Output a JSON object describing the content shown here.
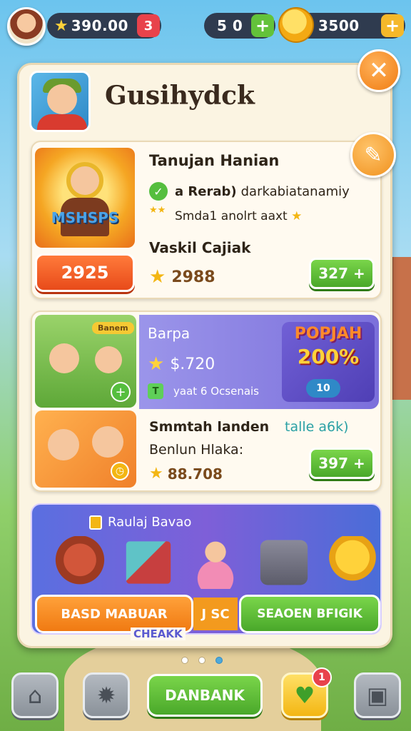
{
  "topbar": {
    "left_value": "390.00",
    "left_badge": "3",
    "mid_value": "5 0",
    "mid_plus": "+",
    "right_value": "3500",
    "right_plus": "+"
  },
  "panel": {
    "title": "Gusihydck",
    "close_label": "✕"
  },
  "card1": {
    "image_label": "MSHSPS",
    "title": "Tanujan Hanian",
    "line1_bold": "a Rerab)",
    "line1_rest": "darkabiatanamiy",
    "line2": "Smda1 anolrt aaxt",
    "heading2": "Vaskil Cajiak",
    "button_left": "2925",
    "price": "2988",
    "button_right": "327 +"
  },
  "card2": {
    "tag": "Banem",
    "violet_heading": "Barpa",
    "violet_price": "$.720",
    "violet_note": "yaat 6 Ocsenais",
    "note_icon": "T",
    "promo_line1": "POPJAH",
    "promo_line2": "200%",
    "promo_toggle": "10",
    "text1": "Smmtah landen",
    "text1_b": "talle a6k)",
    "text2": "Benlun Hlaka:",
    "price2": "88.708",
    "button_right": "397 +"
  },
  "card3": {
    "title": "Raulaj Bavao",
    "button_left": "BASD MABUAR",
    "mid_label": "J SC",
    "button_right": "SEAOEN BFIGIK",
    "sub_label": "CHEAKK"
  },
  "bottom": {
    "main_button": "DANBANK",
    "notif_count": "1"
  },
  "colors": {
    "accent_orange": "#f07c12",
    "accent_green": "#4aa82a",
    "panel_bg": "#fbf4e2",
    "violet": "#7b6fdb"
  }
}
